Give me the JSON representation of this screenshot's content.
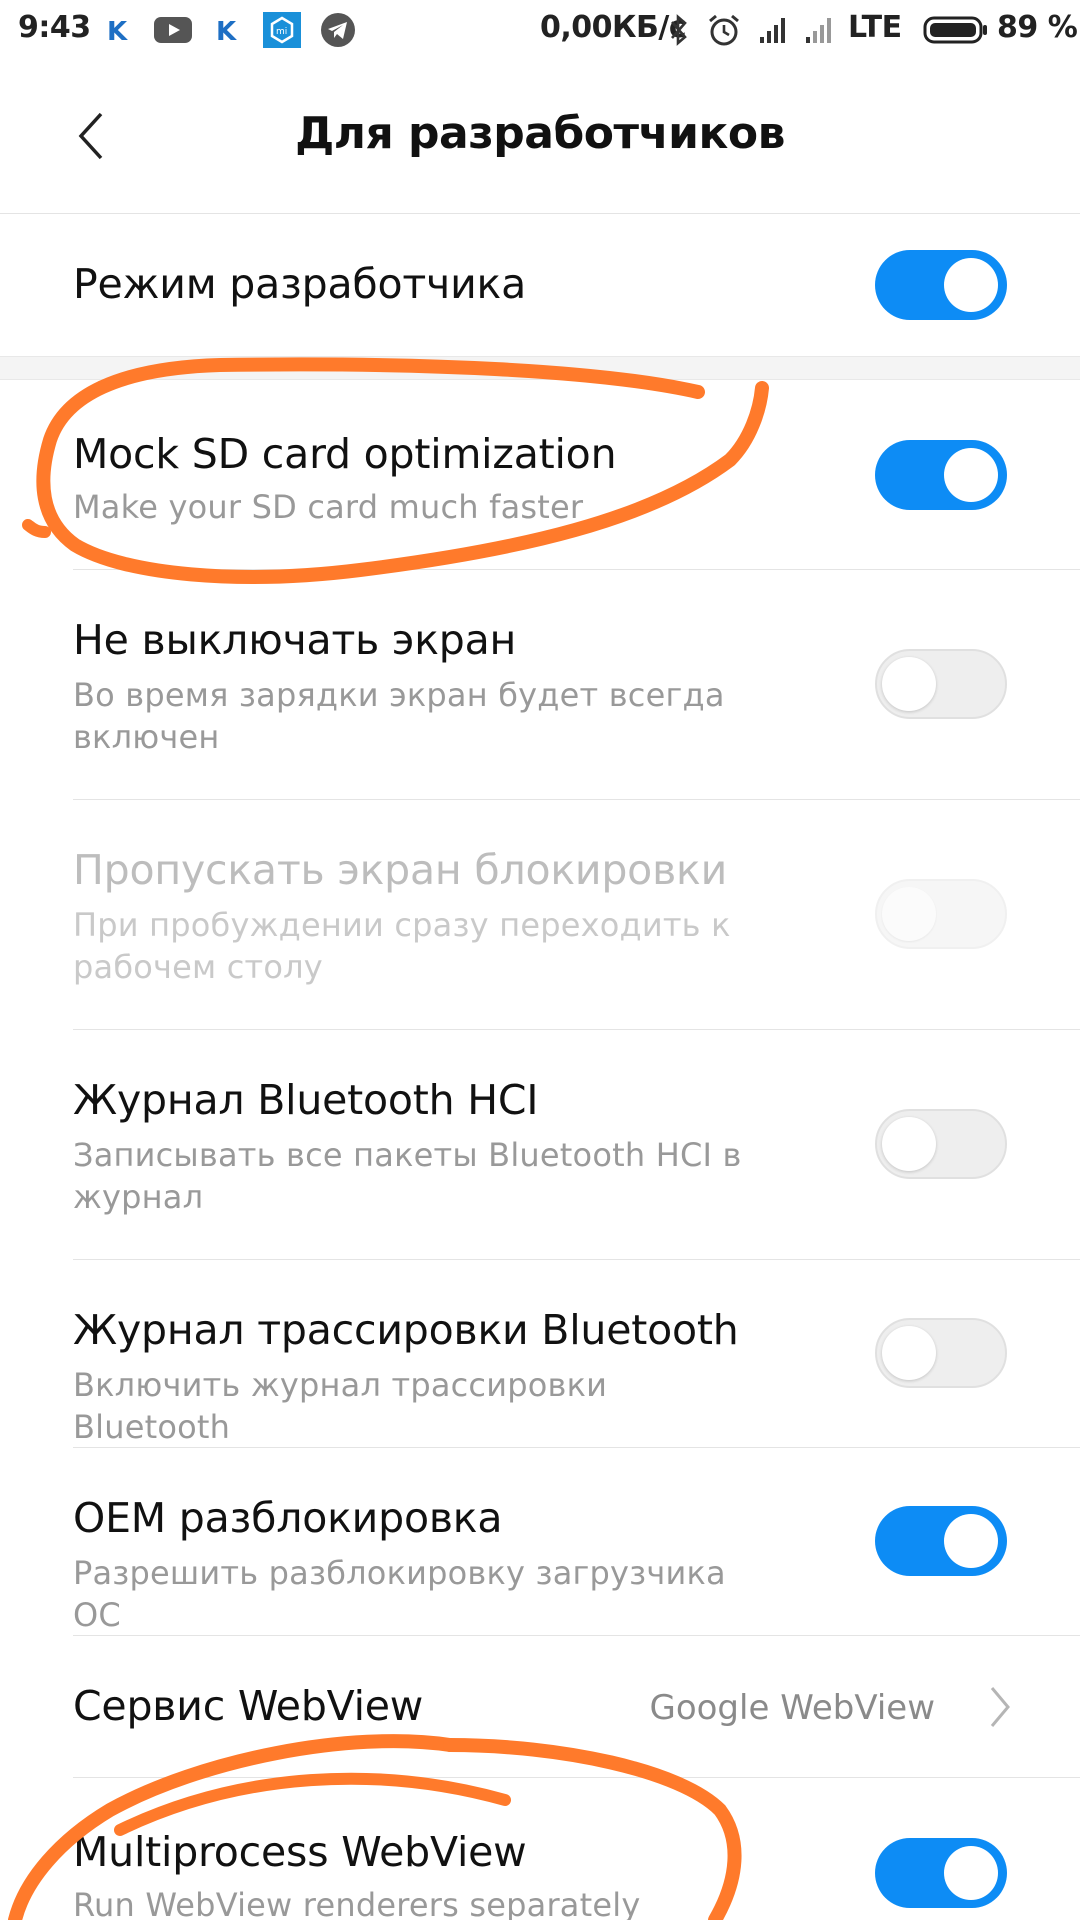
{
  "status_bar": {
    "time": "9:43",
    "network_speed": "0,00КБ/с",
    "network_type": "LTE",
    "battery": "89 %",
    "left_icons": [
      "k-app-icon",
      "youtube-icon",
      "k-app-icon",
      "mi-store-icon",
      "telegram-icon"
    ],
    "right_icons": [
      "bluetooth-icon",
      "alarm-icon",
      "signal-icon",
      "signal-icon",
      "battery-icon"
    ]
  },
  "header": {
    "title": "Для разработчиков",
    "back_icon": "back-arrow-icon"
  },
  "settings": [
    {
      "title": "Режим разработчика",
      "state": "on"
    },
    {
      "title": "Mock SD card optimization",
      "subtitle": "Make your SD card much faster",
      "state": "on"
    },
    {
      "title": "Не выключать экран",
      "subtitle": "Во время зарядки экран будет всегда включен",
      "state": "off"
    },
    {
      "title": "Пропускать экран блокировки",
      "subtitle": "При пробуждении сразу переходить к рабочем столу",
      "state": "disabled"
    },
    {
      "title": "Журнал Bluetooth HCI",
      "subtitle": "Записывать все пакеты Bluetooth HCI в журнал",
      "state": "off"
    },
    {
      "title": "Журнал трассировки Bluetooth",
      "subtitle": "Включить журнал трассировки Bluetooth",
      "state": "off"
    },
    {
      "title": "OEM разблокировка",
      "subtitle": "Разрешить разблокировку загрузчика ОС",
      "state": "on"
    },
    {
      "title": "Сервис WebView",
      "value": "Google WebView"
    },
    {
      "title": "Multiprocess WebView",
      "subtitle": "Run WebView renderers separately",
      "state": "on"
    }
  ],
  "colors": {
    "accent": "#0d8cf5",
    "annotation": "#ff7a2b",
    "subtitle": "#999999"
  }
}
